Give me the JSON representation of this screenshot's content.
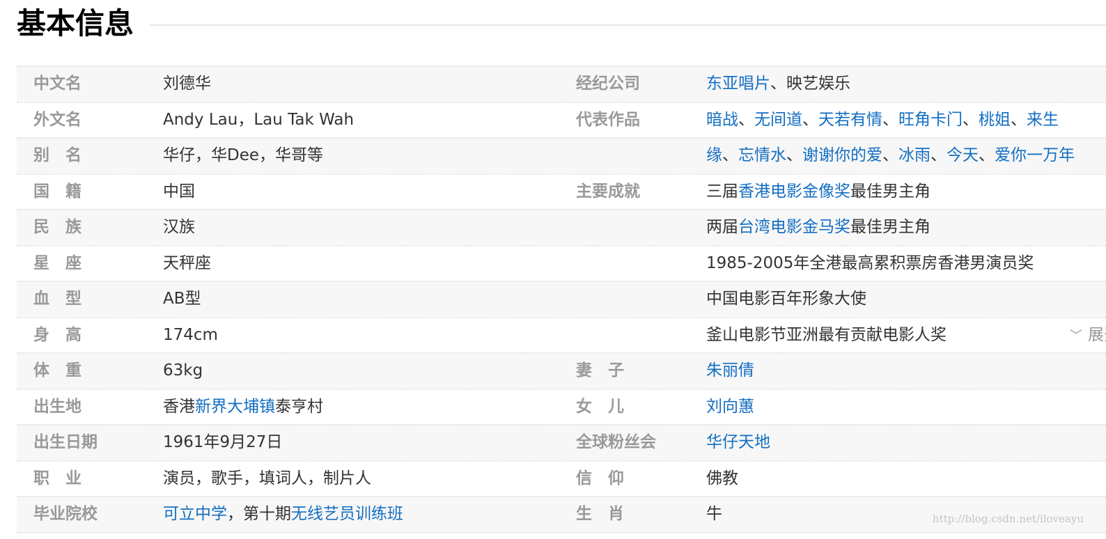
{
  "title": "基本信息",
  "rows": [
    {
      "lk": "中文名",
      "lv": [
        {
          "t": "刘德华"
        }
      ],
      "rk": "经纪公司",
      "rv": [
        {
          "t": "东亚唱片",
          "link": true
        },
        {
          "t": "、映艺娱乐"
        }
      ]
    },
    {
      "lk": "外文名",
      "lv": [
        {
          "t": "Andy Lau，Lau Tak Wah"
        }
      ],
      "rk": "代表作品",
      "rv": [
        {
          "t": "暗战",
          "link": true
        },
        {
          "t": "、"
        },
        {
          "t": "无间道",
          "link": true
        },
        {
          "t": "、"
        },
        {
          "t": "天若有情",
          "link": true
        },
        {
          "t": "、"
        },
        {
          "t": "旺角卡门",
          "link": true
        },
        {
          "t": "、"
        },
        {
          "t": "桃姐",
          "link": true
        },
        {
          "t": "、"
        },
        {
          "t": "来生",
          "link": true
        }
      ]
    },
    {
      "lk": "别　名",
      "lv": [
        {
          "t": "华仔，华Dee，华哥等"
        }
      ],
      "rk": "",
      "rv": [
        {
          "t": "缘",
          "link": true
        },
        {
          "t": "、"
        },
        {
          "t": "忘情水",
          "link": true
        },
        {
          "t": "、"
        },
        {
          "t": "谢谢你的爱",
          "link": true
        },
        {
          "t": "、"
        },
        {
          "t": "冰雨",
          "link": true
        },
        {
          "t": "、"
        },
        {
          "t": "今天",
          "link": true
        },
        {
          "t": "、"
        },
        {
          "t": "爱你一万年",
          "link": true
        }
      ]
    },
    {
      "lk": "国　籍",
      "lv": [
        {
          "t": "中国"
        }
      ],
      "rk": "主要成就",
      "rv": [
        {
          "t": "三届"
        },
        {
          "t": "香港电影金像奖",
          "link": true
        },
        {
          "t": "最佳男主角"
        }
      ]
    },
    {
      "lk": "民　族",
      "lv": [
        {
          "t": "汉族"
        }
      ],
      "rk": "",
      "rv": [
        {
          "t": "两届"
        },
        {
          "t": "台湾电影金马奖",
          "link": true
        },
        {
          "t": "最佳男主角"
        }
      ]
    },
    {
      "lk": "星　座",
      "lv": [
        {
          "t": "天秤座"
        }
      ],
      "rk": "",
      "rv": [
        {
          "t": "1985-2005年全港最高累积票房香港男演员奖"
        }
      ]
    },
    {
      "lk": "血　型",
      "lv": [
        {
          "t": "AB型"
        }
      ],
      "rk": "",
      "rv": [
        {
          "t": "中国电影百年形象大使"
        }
      ]
    },
    {
      "lk": "身　高",
      "lv": [
        {
          "t": "174cm"
        }
      ],
      "rk": "",
      "rv": [
        {
          "t": "釜山电影节亚洲最有贡献电影人奖"
        }
      ],
      "expand": "展开"
    },
    {
      "lk": "体　重",
      "lv": [
        {
          "t": "63kg"
        }
      ],
      "rk": "妻　子",
      "rv": [
        {
          "t": "朱丽倩",
          "link": true
        }
      ]
    },
    {
      "lk": "出生地",
      "lv": [
        {
          "t": "香港"
        },
        {
          "t": "新界大埔镇",
          "link": true
        },
        {
          "t": "泰亨村"
        }
      ],
      "rk": "女　儿",
      "rv": [
        {
          "t": "刘向蕙",
          "link": true
        }
      ]
    },
    {
      "lk": "出生日期",
      "lv": [
        {
          "t": "1961年9月27日"
        }
      ],
      "rk": "全球粉丝会",
      "rv": [
        {
          "t": "华仔天地",
          "link": true
        }
      ]
    },
    {
      "lk": "职　业",
      "lv": [
        {
          "t": "演员，歌手，填词人，制片人"
        }
      ],
      "rk": "信　仰",
      "rv": [
        {
          "t": "佛教"
        }
      ]
    },
    {
      "lk": "毕业院校",
      "lv": [
        {
          "t": "可立中学",
          "link": true
        },
        {
          "t": "，第十期"
        },
        {
          "t": "无线艺员训练班",
          "link": true
        }
      ],
      "rk": "生　肖",
      "rv": [
        {
          "t": "牛"
        }
      ]
    }
  ],
  "watermark": "http://blog.csdn.net/iloveayu"
}
